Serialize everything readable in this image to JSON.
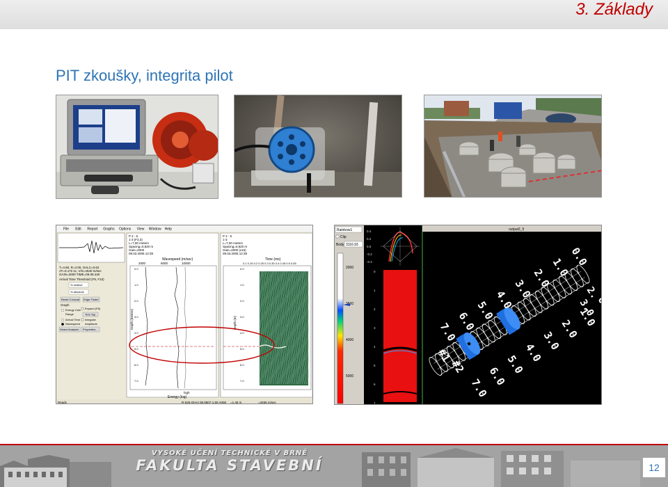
{
  "header": {
    "chapter": "3.  Základy"
  },
  "slide": {
    "title": "PIT zkoušky, integrita pilot",
    "page_number": "12"
  },
  "footer": {
    "university_line1": "VYSOKÉ UČENÍ TECHNICKÉ V BRNĚ",
    "university_line2": "FAKULTA STAVEBNÍ"
  },
  "software_pit": {
    "menu": [
      "File",
      "Edit",
      "Report",
      "Graphs",
      "Options",
      "View",
      "Window",
      "Help"
    ],
    "info_left": [
      "P 2 - 5",
      "1-3 (F3,3)",
      "L=7,00 meters",
      "Spacing=0,820 m",
      "Gain=2000",
      "09.03.2005 12:39"
    ],
    "info_right": [
      "P 2 - 5",
      "1-3",
      "L=7,00 meters",
      "Spacing=0,820 m",
      "Gain=2000 (x16)",
      "09.03.2005 12:39"
    ],
    "params": [
      "T=4.60, R=4.00, OALC=0.62",
      "AT=0.172 sc, V/S=4540 m/sec",
      "GAIN=2000 TIME=09.08.440"
    ],
    "arrival_label": "Arrival Time Threshold (F9, F10)",
    "relative": "% relative",
    "absolute": "% absolute",
    "reset_btn": "Reset Conscat",
    "edge_finder": "Edge Finder",
    "graph_label": "Graph",
    "energy_calc": "Energy Calc.",
    "range": "Range",
    "expand": "Expand (F8)",
    "trim_top": "Trim Top",
    "arrival_time": "Arrival Time",
    "wavespeed": "Wavespeed",
    "integrate": "Integrate",
    "amplitude": "Amplitude",
    "select_analysis": "Select Analysis",
    "properties": "Properties...",
    "wavespeed_title": "Wavespeed (m/sec)",
    "wavespeed_ticks": [
      "2000",
      "6000",
      "10000"
    ],
    "time_title": "Time (ms)",
    "time_ticks": "0.1 0.15 0.2 0.25 0.3 0.35 0.4 0.45 0.5 0.55",
    "depth_label": "Depth (meters)",
    "depth_label2": "Depth (m)",
    "energy_high": "high",
    "energy_label": "Energy (log)",
    "status_ready": "Ready",
    "status_mid": "R-026-OHAI 08,0807-1,50 A006",
    "status_right1": "=1,46 m",
    "status_right2": "=3456 m/sec",
    "depth_ticks": [
      "0.0",
      "1.0",
      "2.0",
      "3.0",
      "4.0",
      "5.0",
      "6.0",
      "7.0"
    ]
  },
  "software_3d": {
    "palette_select": "Rainbow1",
    "clip": "Clip",
    "body_label": "Body",
    "body_value": "3116.93",
    "scale_values": [
      "2000",
      "3500",
      "4000",
      "5000"
    ],
    "plot_values": [
      "0.4",
      "0.2",
      "0.0",
      "-0.2",
      "-0.4"
    ],
    "axis_ticks": [
      "0",
      "1",
      "2",
      "3",
      "4",
      "5",
      "6",
      "7"
    ],
    "window_title": "output2_5",
    "pile_labels": [
      "#1",
      "#2"
    ],
    "labels_a": [
      "0.0",
      "1.0",
      "2.0",
      "3.0",
      "4.0",
      "5.0",
      "6.0",
      "7.0"
    ],
    "labels_b": [
      "0.0",
      "1.0",
      "2.0",
      "3.0",
      "4.0",
      "5.0",
      "6.0",
      "7.0"
    ],
    "extra_labels": [
      "2.",
      "3.0"
    ]
  },
  "colors": {
    "accent": "#2e74b5",
    "chapter": "#c00000"
  }
}
